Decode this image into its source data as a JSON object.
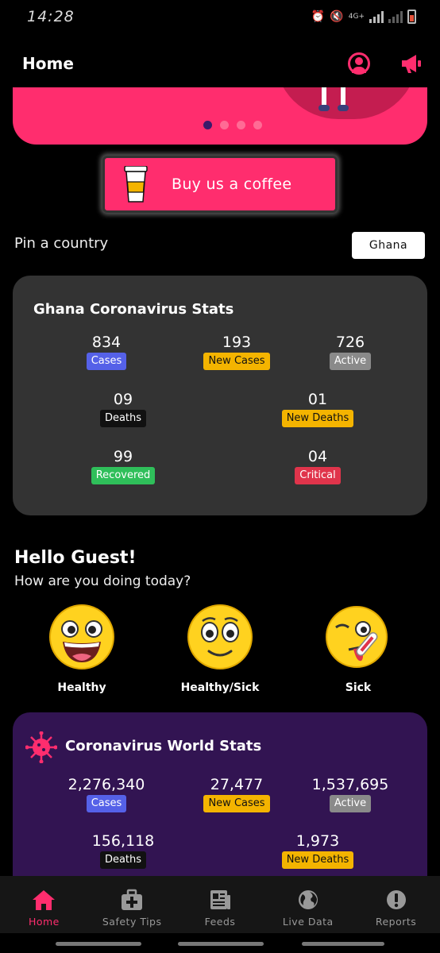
{
  "status": {
    "time": "14:28",
    "network": "4G+"
  },
  "appbar": {
    "title": "Home",
    "profile_icon": "profile-icon",
    "announce_icon": "megaphone-icon"
  },
  "carousel": {
    "pages": 4,
    "active_index": 0
  },
  "coffee": {
    "label": "Buy us a coffee"
  },
  "pin": {
    "label": "Pin a country",
    "selected": "Ghana"
  },
  "country_stats": {
    "title": "Ghana Coronavirus Stats",
    "cases": "834",
    "cases_label": "Cases",
    "new_cases": "193",
    "new_cases_label": "New Cases",
    "active": "726",
    "active_label": "Active",
    "deaths": "09",
    "deaths_label": "Deaths",
    "new_deaths": "01",
    "new_deaths_label": "New Deaths",
    "recovered": "99",
    "recovered_label": "Recovered",
    "critical": "04",
    "critical_label": "Critical"
  },
  "greeting": {
    "title": "Hello Guest!",
    "subtitle": "How are you doing today?"
  },
  "moods": [
    {
      "label": "Healthy"
    },
    {
      "label": "Healthy/Sick"
    },
    {
      "label": "Sick"
    }
  ],
  "world_stats": {
    "title": "Coronavirus World Stats",
    "cases": "2,276,340",
    "cases_label": "Cases",
    "new_cases": "27,477",
    "new_cases_label": "New Cases",
    "active": "1,537,695",
    "active_label": "Active",
    "deaths": "156,118",
    "deaths_label": "Deaths",
    "new_deaths": "1,973",
    "new_deaths_label": "New Deaths"
  },
  "nav": [
    {
      "label": "Home",
      "icon": "home-icon"
    },
    {
      "label": "Safety Tips",
      "icon": "first-aid-icon"
    },
    {
      "label": "Feeds",
      "icon": "newspaper-icon"
    },
    {
      "label": "Live Data",
      "icon": "globe-icon"
    },
    {
      "label": "Reports",
      "icon": "alert-icon"
    }
  ],
  "colors": {
    "accent": "#ff2d6e",
    "card": "#333333",
    "world_card": "#321452"
  }
}
